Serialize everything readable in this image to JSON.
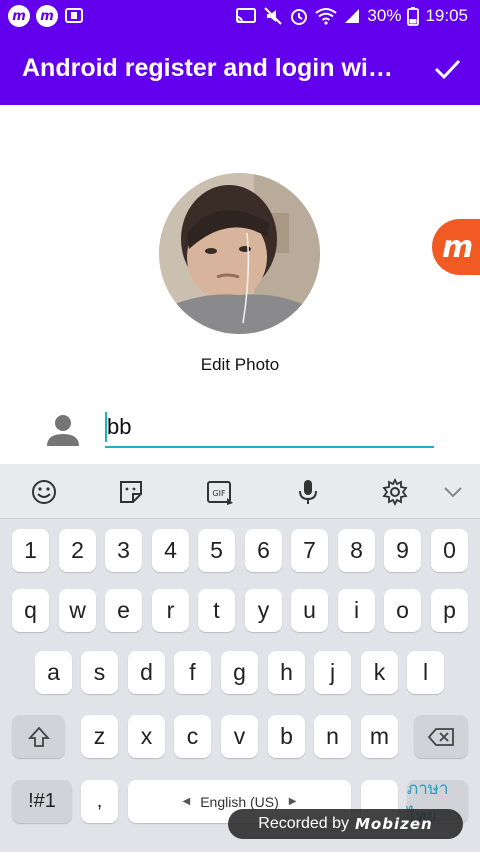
{
  "status_bar": {
    "battery": "30%",
    "time": "19:05",
    "colors": {
      "bar": "#6200ee"
    }
  },
  "app_bar": {
    "title": "Android register and login wi…",
    "confirm_icon": "check-icon",
    "color": "#6200ee"
  },
  "profile": {
    "edit_photo_label": "Edit Photo",
    "name_value": "bb"
  },
  "keyboard": {
    "toolbar": [
      "emoji-icon",
      "sticker-icon",
      "gif-icon",
      "microphone-icon",
      "settings-icon",
      "chevron-down-icon"
    ],
    "gif_label": "GIF",
    "number_row": [
      "1",
      "2",
      "3",
      "4",
      "5",
      "6",
      "7",
      "8",
      "9",
      "0"
    ],
    "row1": [
      "q",
      "w",
      "e",
      "r",
      "t",
      "y",
      "u",
      "i",
      "o",
      "p"
    ],
    "row2": [
      "a",
      "s",
      "d",
      "f",
      "g",
      "h",
      "j",
      "k",
      "l"
    ],
    "row3": [
      "z",
      "x",
      "c",
      "v",
      "b",
      "n",
      "m"
    ],
    "symbols_key": "!#1",
    "comma_key": ",",
    "space_label": "English (US)",
    "lang_key": "ภาษาไทย",
    "accent": "#1ab4c1"
  },
  "watermark": {
    "prefix": "Recorded by",
    "logo": "Mobizen"
  }
}
